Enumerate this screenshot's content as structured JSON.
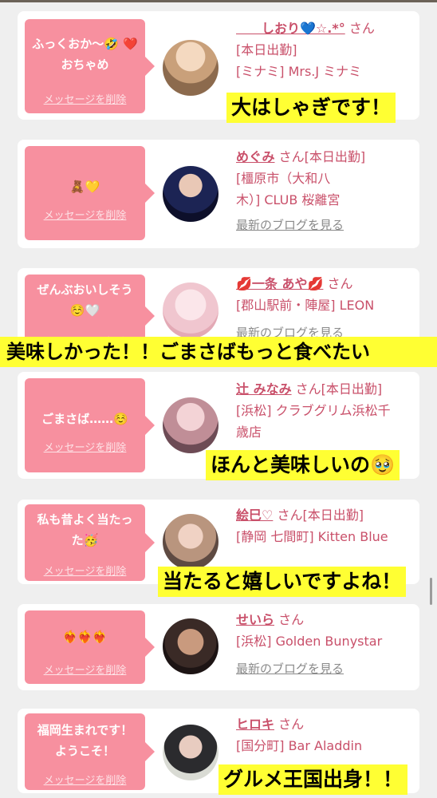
{
  "cards": [
    {
      "bubble_text": "ふっくおか〜🤣 ❤️おちゃめ",
      "delete_label": "メッセージを削除",
      "name": "　　しおり💙☆.*°",
      "san": "さん",
      "line1": "[本日出勤]",
      "line2": "[ミナミ] Mrs.J ミナミ",
      "blog": ""
    },
    {
      "bubble_text": "🧸💛",
      "delete_label": "メッセージを削除",
      "name": "めぐみ",
      "san": "さん[本日出勤]",
      "line1": "[橿原市（大和八",
      "line2": "木）] CLUB 桜離宮",
      "blog": "最新のブログを見る"
    },
    {
      "bubble_text": "ぜんぶおいしそう ☺️🤍",
      "delete_label": "メッセージを削除",
      "name": "💋一条 あや💋",
      "san": "さん",
      "line1": "[郡山駅前・陣屋] LEON",
      "line2": "",
      "blog": "最新のブログを見る"
    },
    {
      "bubble_text": "ごまさば……☺️",
      "delete_label": "メッセージを削除",
      "name": "辻 みなみ",
      "san": "さん[本日出勤]",
      "line1": "[浜松] クラブグリム浜松千",
      "line2": "歳店",
      "blog": ""
    },
    {
      "bubble_text": "私も昔よく当たっ た🥳",
      "delete_label": "メッセージを削除",
      "name": "絵巳♡",
      "san": "さん[本日出勤]",
      "line1": "[静岡 七間町] Kitten Blue",
      "line2": "",
      "blog": ""
    },
    {
      "bubble_text": "❤️‍🔥❤️‍🔥❤️‍🔥",
      "delete_label": "メッセージを削除",
      "name": "せいら",
      "san": "さん",
      "line1": "[浜松] Golden Bunystar",
      "line2": "",
      "blog": "最新のブログを見る"
    },
    {
      "bubble_text": "福岡生まれです！ ようこそ！",
      "delete_label": "メッセージを削除",
      "name": "ヒロキ",
      "san": "さん",
      "line1": "[国分町] Bar Aladdin",
      "line2": "",
      "blog": ""
    }
  ],
  "captions": [
    "大はしゃぎです！",
    "美味しかった！！ごまさばもっと食べたい",
    "ほんと美味しいの🥹",
    "当たると嬉しいですよね！",
    "グルメ王国出身！！"
  ],
  "colors": {
    "accent": "#f7909f",
    "name_pink": "#c9506a",
    "caption_yellow": "#ffff33"
  }
}
